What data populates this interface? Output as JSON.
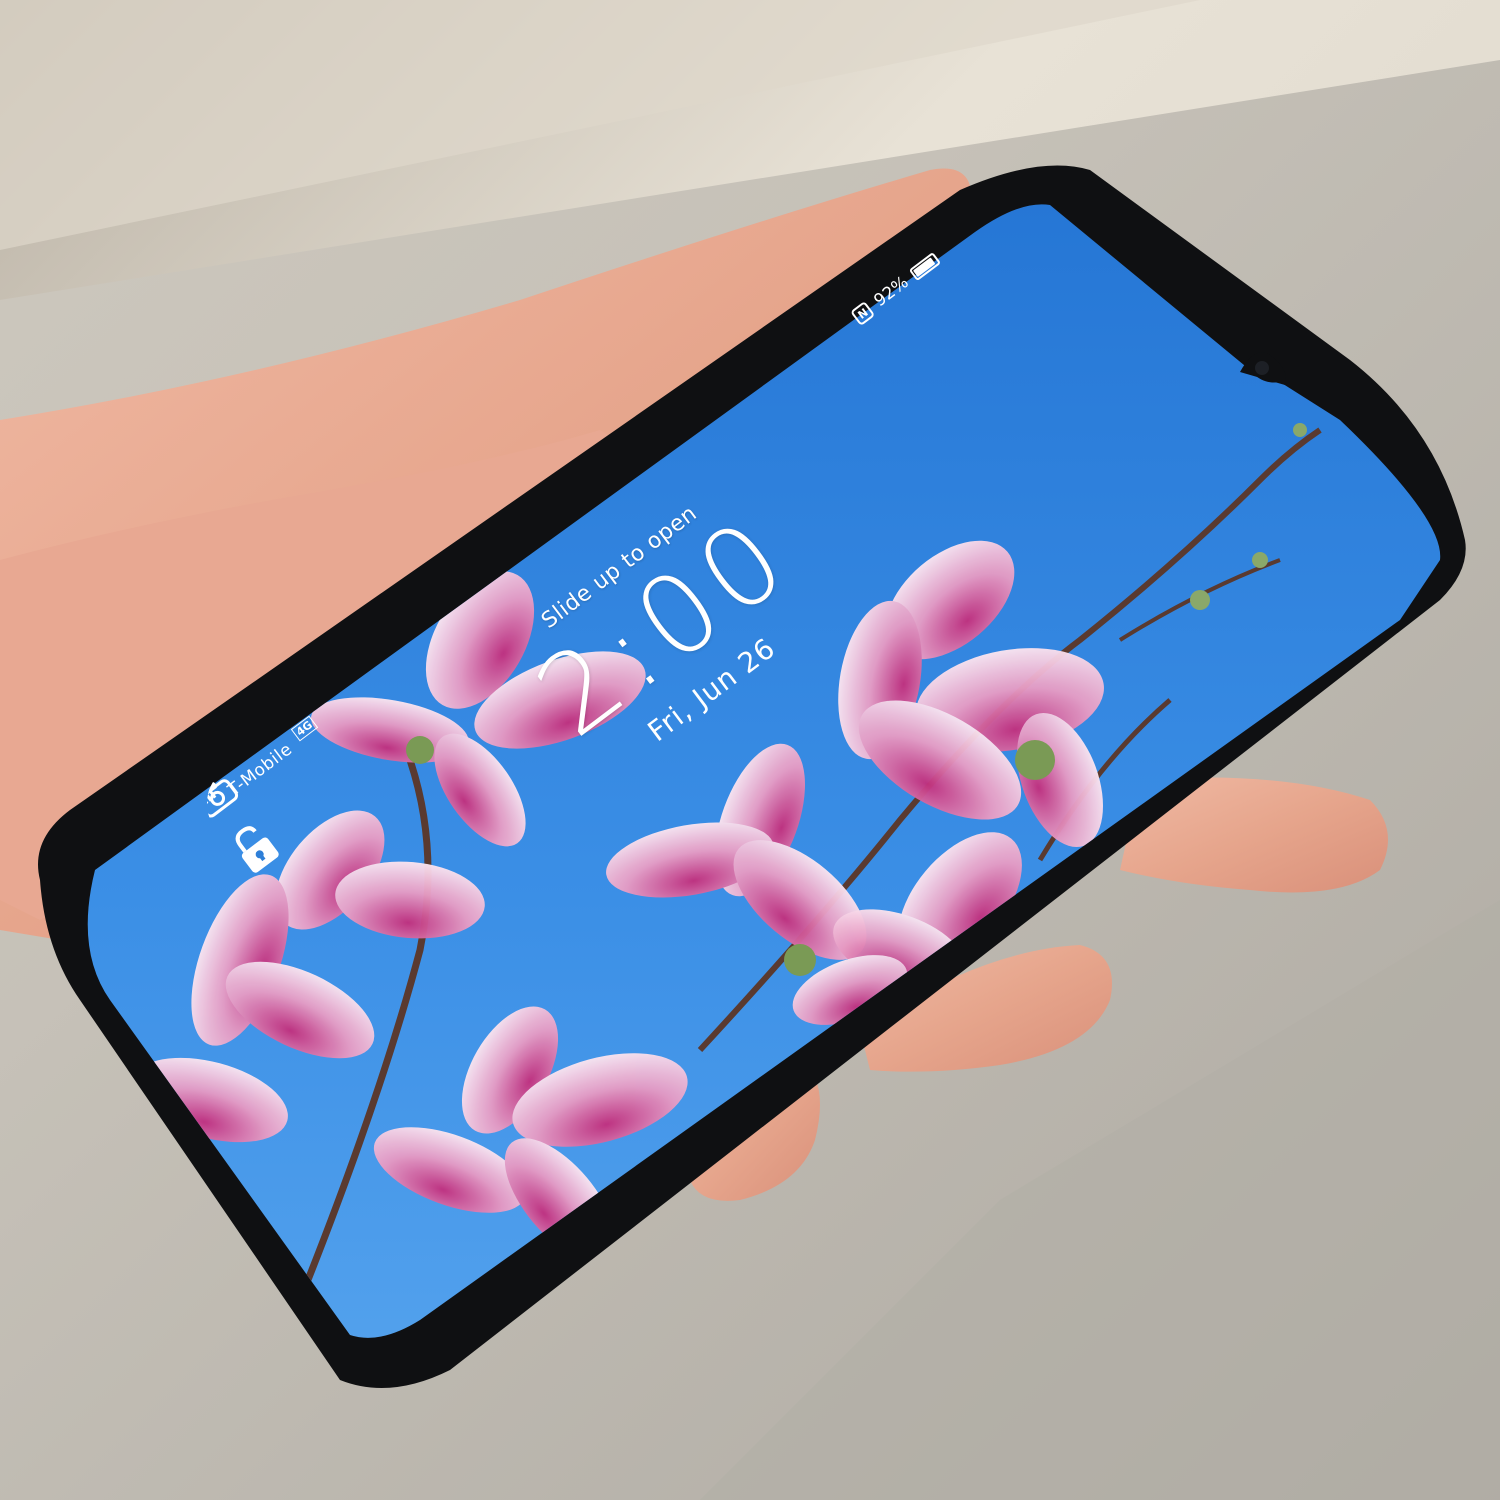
{
  "scene": {
    "background_color": "#cfc9bf",
    "floor_color": "#b7b4ad",
    "wall_color": "#e5dfd3",
    "skin_color": "#e8a992",
    "phone_frame_color": "#111214",
    "screen_sky_color": "#2e7fd8",
    "flower_color": "#e69bc0"
  },
  "status_bar": {
    "carrier": "T-Mobile",
    "network": "4G",
    "battery_percent": "92%",
    "battery_level": 0.92,
    "icons": [
      "signal-icon",
      "nfc-icon",
      "battery-icon"
    ]
  },
  "lock_screen": {
    "unlock_hint": "Slide up to open",
    "time": "2:00",
    "date": "Fri, Jun 26",
    "icons": [
      "unlock-icon",
      "camera-icon"
    ]
  }
}
